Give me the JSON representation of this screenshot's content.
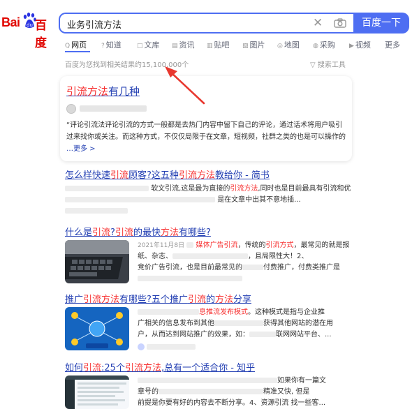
{
  "logo": {
    "bai": "Bai",
    "du_text": "百度"
  },
  "search": {
    "query": "业务引流方法",
    "button_label": "百度一下"
  },
  "tabs": [
    {
      "icon": "Q",
      "label": "网页"
    },
    {
      "icon": "?",
      "label": "知道"
    },
    {
      "icon": "□",
      "label": "文库"
    },
    {
      "icon": "▤",
      "label": "资讯"
    },
    {
      "icon": "▥",
      "label": "贴吧"
    },
    {
      "icon": "▨",
      "label": "图片"
    },
    {
      "icon": "◎",
      "label": "地图"
    },
    {
      "icon": "◍",
      "label": "采购"
    },
    {
      "icon": "▶",
      "label": "视频"
    },
    {
      "icon": "",
      "label": "更多"
    }
  ],
  "stats": {
    "result_count": "百度为您找到相关结果约15,100,000个",
    "tools_label": "搜索工具"
  },
  "card": {
    "title_red": "引流方法",
    "title_rest": "有几种",
    "snippet": "“评论引流法评论引流的方式一般都是去热门内容中留下自己的评论，通过话术将用户吸引过来找你或关注。而这种方式，不仅仅局限于在文章，短视频，社群之类的也是可以操作的",
    "more": "…更多 >"
  },
  "results": [
    {
      "title_a": "怎么样快速",
      "title_b": "引流",
      "title_c": "顾客?这五种",
      "title_d": "引流方法",
      "title_e": "教给你 - 简书",
      "snippet_1": "软文引流,这是最为直接的",
      "snippet_1_red": "引流方法",
      "snippet_1_tail": ",同时也是目前最具有引流和优",
      "snippet_2": "是在文章中出其不意地插..."
    },
    {
      "title_a": "什么是",
      "title_b": "引流",
      "title_c": "?",
      "title_d": "引流",
      "title_e": "的最快",
      "title_f": "方法",
      "title_g": "有哪些?",
      "date": "2021年11月8日",
      "snippet_1_red_a": "媒体广告引流",
      "snippet_1_mid": "，传统的",
      "snippet_1_red_b": "引流方式",
      "snippet_1_tail": "，最常见的就是报",
      "snippet_2": "纸、杂志、",
      "snippet_2_tail": "，且局限性大！2、",
      "snippet_3": "竞价广告引流，也是目前最常见的",
      "snippet_3_tail": "付费推广，付费类推广是"
    },
    {
      "title_a": "推广",
      "title_b": "引流方法",
      "title_c": "有哪些?五个推广",
      "title_d": "引流",
      "title_e": "的",
      "title_f": "方法",
      "title_g": "分享",
      "snippet_1_red": "息推流发布模式",
      "snippet_1_tail": "。这种模式是指与企业推",
      "snippet_2": "广相关的信息发布到其他",
      "snippet_2_tail": "获得其他网站的潜在用",
      "snippet_3": "户，从而达到网站推广的效果，如：",
      "snippet_3_tail": "联网网站平台、..."
    },
    {
      "title_a": "如何",
      "title_b": "引流",
      "title_c": ":25个",
      "title_d": "引流方法",
      "title_e": ",总有一个适合你 - 知乎",
      "snippet_1_tail": "如果你有一篇文",
      "snippet_2": "章号的",
      "snippet_2_tail": "精准又快, 但是",
      "snippet_3": "前提是你要有好的内容去不断分享。4、资源引流 找一些客..."
    }
  ],
  "colors": {
    "accent": "#4e6ef2",
    "link": "#2440b3",
    "highlight": "#f73131",
    "arrow": "#e8382f"
  }
}
